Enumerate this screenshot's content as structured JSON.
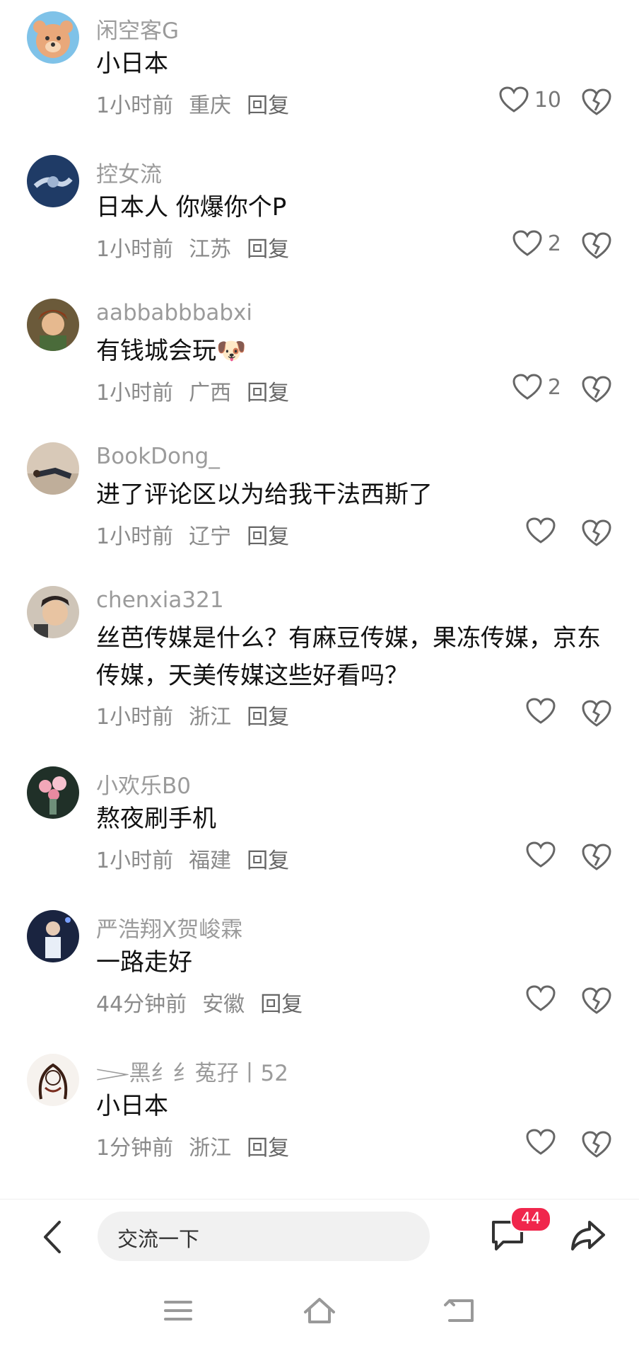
{
  "comments": [
    {
      "username": "闲空客G",
      "content": "小日本",
      "time": "1小时前",
      "location": "重庆",
      "reply": "回复",
      "likes": "10",
      "avatar": "bear-avatar"
    },
    {
      "username": "控女流",
      "content": "日本人 你爆你个P",
      "time": "1小时前",
      "location": "江苏",
      "reply": "回复",
      "likes": "2",
      "avatar": "handshake-avatar"
    },
    {
      "username": "aabbabbbabxi",
      "content": "有钱城会玩🐶",
      "time": "1小时前",
      "location": "广西",
      "reply": "回复",
      "likes": "2",
      "avatar": "warrior-avatar"
    },
    {
      "username": "BookDong_",
      "content": "进了评论区以为给我干法西斯了",
      "time": "1小时前",
      "location": "辽宁",
      "reply": "回复",
      "likes": "",
      "avatar": "lying-person-avatar"
    },
    {
      "username": "chenxia321",
      "content": "丝芭传媒是什么？有麻豆传媒，果冻传媒，京东传媒，天美传媒这些好看吗？",
      "time": "1小时前",
      "location": "浙江",
      "reply": "回复",
      "likes": "",
      "avatar": "man-portrait-avatar"
    },
    {
      "username": "小欢乐B0",
      "content": "熬夜刷手机",
      "time": "1小时前",
      "location": "福建",
      "reply": "回复",
      "likes": "",
      "avatar": "flowers-avatar"
    },
    {
      "username": "严浩翔X贺峻霖",
      "content": "一路走好",
      "time": "44分钟前",
      "location": "安徽",
      "reply": "回复",
      "likes": "",
      "avatar": "singer-avatar"
    },
    {
      "username": "𝆓黑纟纟菟孖丨52",
      "content": "小日本",
      "time": "1分钟前",
      "location": "浙江",
      "reply": "回复",
      "likes": "",
      "avatar": "sketch-girl-avatar"
    }
  ],
  "input": {
    "placeholder": "交流一下"
  },
  "comment_count": "44",
  "icons": {
    "back": "back-arrow-icon",
    "comment": "comment-bubble-icon",
    "share": "share-arrow-icon",
    "like": "heart-icon",
    "dislike": "broken-heart-icon",
    "nav_menu": "menu-icon",
    "nav_home": "home-icon",
    "nav_back": "return-icon"
  },
  "colors": {
    "badge": "#f0264c",
    "meta": "#8a8a8a",
    "username": "#9b9b9b"
  }
}
